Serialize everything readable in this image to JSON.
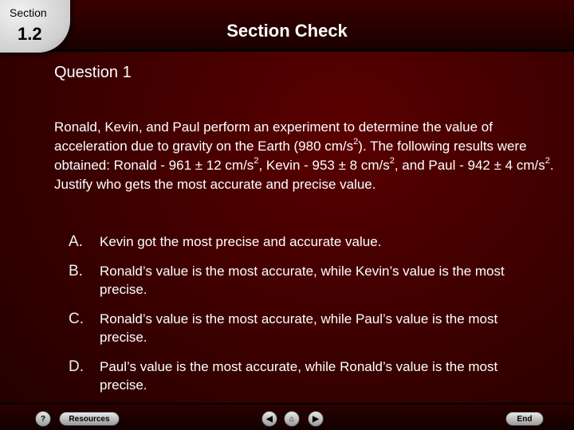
{
  "header": {
    "section_label": "Section",
    "section_number": "1.2",
    "title": "Section Check"
  },
  "question": {
    "heading": "Question 1",
    "text_part1": "Ronald, Kevin, and Paul perform an experiment to determine the value of acceleration due to gravity on the Earth (980 cm/s",
    "sup1": "2",
    "text_part2": "). The following results were obtained: Ronald - 961 ± 12 cm/s",
    "sup2": "2",
    "text_part3": ", Kevin - 953 ± 8 cm/s",
    "sup3": "2",
    "text_part4": ", and Paul - 942 ± 4 cm/s",
    "sup4": "2",
    "text_part5": ".",
    "instruction": "Justify who gets the most accurate and precise value."
  },
  "answers": [
    {
      "letter": "A.",
      "text": "Kevin got the most precise and accurate value."
    },
    {
      "letter": "B.",
      "text": "Ronald’s value is the most accurate, while Kevin’s value is the most precise."
    },
    {
      "letter": "C.",
      "text": "Ronald’s value is the most accurate, while Paul’s value is the most precise."
    },
    {
      "letter": "D.",
      "text": "Paul’s value is the most accurate, while Ronald’s value is the most precise."
    }
  ],
  "nav": {
    "help": "?",
    "resources": "Resources",
    "prev_icon": "◀",
    "home_icon": "⌂",
    "next_icon": "▶",
    "end": "End"
  },
  "colors": {
    "background": "#3a0000",
    "text": "#ffffff"
  }
}
